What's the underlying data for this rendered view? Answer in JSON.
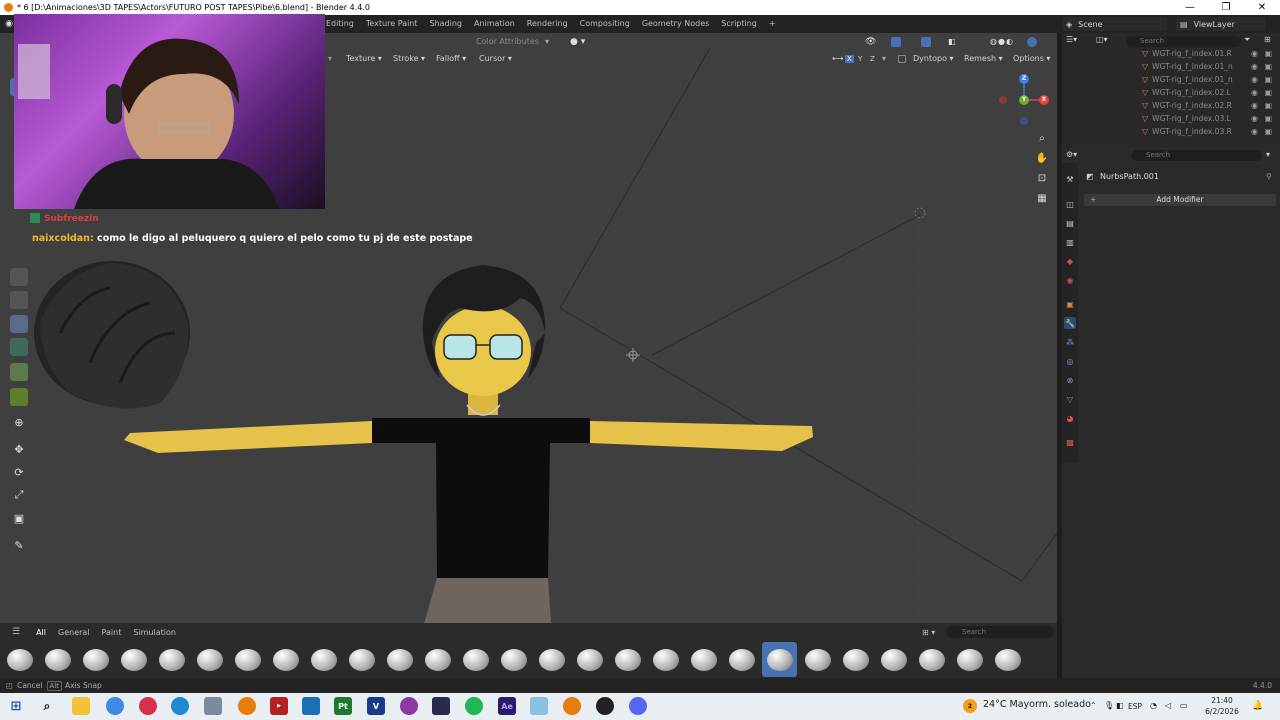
{
  "window": {
    "title": "* 6 [D:\\Animaciones\\3D TAPES\\Actors\\FUTURO POST TAPES\\Pibe\\6.blend] - Blender 4.4.0",
    "controls": [
      "—",
      "❐",
      "✕"
    ]
  },
  "workspaces": [
    "Editing",
    "Texture Paint",
    "Shading",
    "Animation",
    "Rendering",
    "Compositing",
    "Geometry Nodes",
    "Scripting",
    "+"
  ],
  "scene": {
    "label": "Scene",
    "view_layer": "ViewLayer"
  },
  "viewport": {
    "header_left": "Color Attributes",
    "menus": [
      "Texture",
      "Stroke",
      "Falloff",
      "Cursor"
    ],
    "axes": [
      "X",
      "Y",
      "Z"
    ],
    "right_tools": [
      "Dyntopo",
      "Remesh",
      "Options"
    ],
    "gizmo_labels": {
      "x": "X",
      "y": "Y",
      "z": "Z"
    }
  },
  "chat": {
    "user1": "Subfreezin",
    "message_user": "naixcoldan:",
    "message_text": " como le digo al peluquero q quiero el pelo como tu pj de este postape"
  },
  "asset_browser": {
    "tabs": [
      "All",
      "General",
      "Paint",
      "Simulation"
    ],
    "search_placeholder": "Search",
    "brush_count": 27,
    "selected_index": 20
  },
  "status": {
    "cancel": "Cancel",
    "alt_key": "Alt",
    "axis_snap": "Axis Snap",
    "version": "4.4.0"
  },
  "outliner": {
    "search_placeholder": "Search",
    "items": [
      "WGT-rig_f_index.01.R",
      "WGT-rig_f_index.01_n",
      "WGT-rig_f_index.01_n",
      "WGT-rig_f_index.02.L",
      "WGT-rig_f_index.02.R",
      "WGT-rig_f_index.03.L",
      "WGT-rig_f_index.03.R"
    ]
  },
  "properties": {
    "search_placeholder": "Search",
    "object_name": "NurbsPath.001",
    "add_modifier": "Add Modifier"
  },
  "taskbar": {
    "weather_temp": "24°C",
    "weather_desc": "Mayorm. soleado",
    "language": "ESP",
    "time": "21:40",
    "date": "6/2/2026",
    "weather_badge": "2"
  },
  "colors": {
    "accent": "#4772b3",
    "blender_orange": "#e87d0d",
    "chat_username": "#f2b930",
    "axis_x": "#e5423f",
    "axis_y": "#6bad32",
    "axis_z": "#3a7ee0"
  }
}
